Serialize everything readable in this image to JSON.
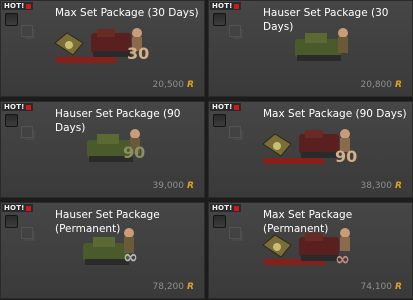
{
  "hot_label": "HOT!",
  "currency_icon": "rz-coin-icon",
  "accent_color": "#e0a020",
  "cards": [
    {
      "title": "Max Set Package (30 Days)",
      "price": "20,500",
      "badge": "30",
      "variant": "max"
    },
    {
      "title": "Hauser Set Package (30 Days)",
      "price": "20,800",
      "badge": "",
      "variant": "hauser"
    },
    {
      "title": "Hauser Set Package (90 Days)",
      "price": "39,000",
      "badge": "90",
      "variant": "hauser"
    },
    {
      "title": "Max Set Package (90 Days)",
      "price": "38,300",
      "badge": "90",
      "variant": "max"
    },
    {
      "title": "Hauser Set Package (Permanent)",
      "price": "78,200",
      "badge": "∞",
      "variant": "hauser"
    },
    {
      "title": "Max Set Package (Permanent)",
      "price": "74,100",
      "badge": "∞",
      "variant": "max"
    }
  ]
}
